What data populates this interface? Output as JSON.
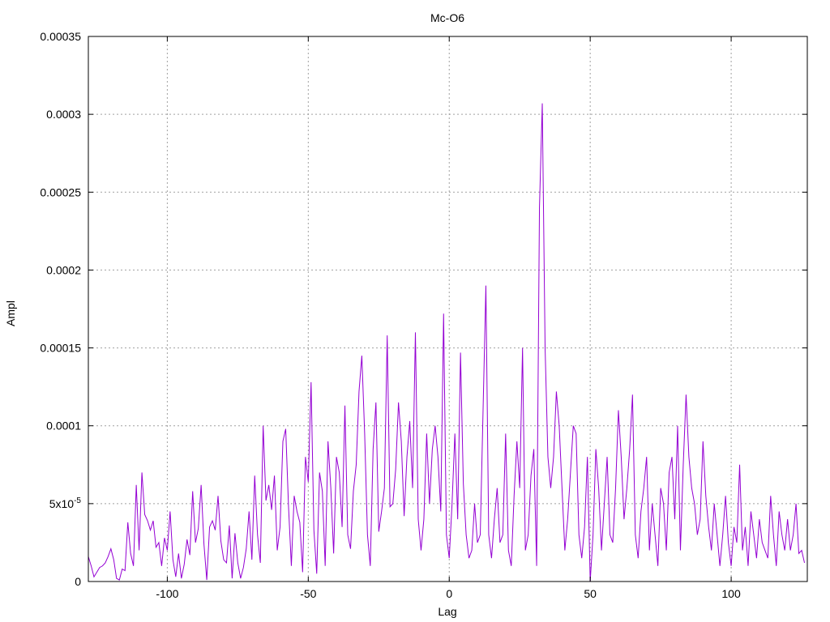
{
  "chart_data": {
    "type": "line",
    "title": "Mc-O6",
    "xlabel": "Lag",
    "ylabel": "Ampl",
    "xlim": [
      -128,
      127
    ],
    "ylim": [
      0,
      0.00035
    ],
    "grid": true,
    "x_ticks": [
      {
        "value": -100,
        "label": "-100"
      },
      {
        "value": -50,
        "label": "-50"
      },
      {
        "value": 0,
        "label": "0"
      },
      {
        "value": 50,
        "label": "50"
      },
      {
        "value": 100,
        "label": "100"
      }
    ],
    "y_ticks": [
      {
        "value": 0,
        "label": "0"
      },
      {
        "value": 5e-05,
        "label": "5x10",
        "sup": "-5"
      },
      {
        "value": 0.0001,
        "label": "0.0001"
      },
      {
        "value": 0.00015,
        "label": "0.00015"
      },
      {
        "value": 0.0002,
        "label": "0.0002"
      },
      {
        "value": 0.00025,
        "label": "0.00025"
      },
      {
        "value": 0.0003,
        "label": "0.0003"
      },
      {
        "value": 0.00035,
        "label": "0.00035"
      }
    ],
    "series": [
      {
        "color": "#9400d3",
        "x_start": -128,
        "x_step": 1,
        "values": [
          1.6e-05,
          1e-05,
          3e-06,
          6e-06,
          9e-06,
          1e-05,
          1.2e-05,
          1.6e-05,
          2.1e-05,
          1.4e-05,
          2e-06,
          1e-06,
          8e-06,
          7e-06,
          3.8e-05,
          1.8e-05,
          1e-05,
          6.2e-05,
          2e-05,
          7e-05,
          4.3e-05,
          3.9e-05,
          3.3e-05,
          3.9e-05,
          2.2e-05,
          2.5e-05,
          1e-05,
          2.8e-05,
          2e-05,
          4.5e-05,
          1.4e-05,
          3e-06,
          1.8e-05,
          2e-06,
          1.1e-05,
          2.7e-05,
          1.7e-05,
          5.8e-05,
          2.5e-05,
          3.4e-05,
          6.2e-05,
          2.4e-05,
          1e-06,
          3.5e-05,
          3.9e-05,
          3.3e-05,
          5.5e-05,
          2.6e-05,
          1.4e-05,
          1.2e-05,
          3.6e-05,
          2e-06,
          3.1e-05,
          1.2e-05,
          2e-06,
          9e-06,
          2.1e-05,
          4.5e-05,
          1.4e-05,
          6.8e-05,
          3e-05,
          1.2e-05,
          0.0001,
          5.2e-05,
          6.2e-05,
          4.6e-05,
          6.8e-05,
          2e-05,
          3.5e-05,
          9e-05,
          9.8e-05,
          4.8e-05,
          1e-05,
          5.5e-05,
          4.5e-05,
          3.8e-05,
          6e-06,
          8e-05,
          6.4e-05,
          0.000128,
          3.3e-05,
          5e-06,
          7e-05,
          5.8e-05,
          1e-05,
          9e-05,
          6e-05,
          1.8e-05,
          8e-05,
          7e-05,
          3.5e-05,
          0.000113,
          3e-05,
          2.1e-05,
          5.8e-05,
          7.5e-05,
          0.000122,
          0.000145,
          9.5e-05,
          3e-05,
          1e-05,
          8.5e-05,
          0.000115,
          3.2e-05,
          4.5e-05,
          6e-05,
          0.000158,
          4.8e-05,
          5e-05,
          7.2e-05,
          0.000115,
          9e-05,
          4.2e-05,
          8e-05,
          0.000103,
          6e-05,
          0.00016,
          4e-05,
          2e-05,
          4e-05,
          9.5e-05,
          5e-05,
          8.5e-05,
          0.0001,
          8e-05,
          4.5e-05,
          0.000172,
          3e-05,
          1.5e-05,
          5e-05,
          9.5e-05,
          4e-05,
          0.000147,
          6.3e-05,
          3e-05,
          1.5e-05,
          2e-05,
          5e-05,
          2.5e-05,
          3e-05,
          0.00011,
          0.00019,
          3e-05,
          1.5e-05,
          4e-05,
          6e-05,
          2.5e-05,
          3e-05,
          9.5e-05,
          2e-05,
          1e-05,
          5.5e-05,
          9e-05,
          6e-05,
          0.00015,
          2e-05,
          3e-05,
          6.8e-05,
          8.5e-05,
          1e-05,
          0.00024,
          0.000307,
          0.00015,
          8e-05,
          6e-05,
          8e-05,
          0.000122,
          0.0001,
          6e-05,
          2e-05,
          4e-05,
          7e-05,
          0.0001,
          9.5e-05,
          3e-05,
          1.5e-05,
          3.5e-05,
          8e-05,
          0.0,
          3e-05,
          8.5e-05,
          6e-05,
          2e-05,
          5e-05,
          8e-05,
          3e-05,
          2.5e-05,
          6e-05,
          0.00011,
          8e-05,
          4e-05,
          6e-05,
          8.5e-05,
          0.00012,
          3e-05,
          1.5e-05,
          4.5e-05,
          6e-05,
          8e-05,
          2e-05,
          5e-05,
          3e-05,
          1e-05,
          6e-05,
          5e-05,
          2e-05,
          7e-05,
          8e-05,
          4e-05,
          0.0001,
          2e-05,
          7.5e-05,
          0.00012,
          8e-05,
          6e-05,
          5e-05,
          3e-05,
          4e-05,
          9e-05,
          5.5e-05,
          3.5e-05,
          2e-05,
          5e-05,
          3e-05,
          1e-05,
          3e-05,
          5.5e-05,
          2.5e-05,
          1e-05,
          3.5e-05,
          2.5e-05,
          7.5e-05,
          2e-05,
          3.5e-05,
          1e-05,
          4.5e-05,
          3e-05,
          1.5e-05,
          4e-05,
          2.5e-05,
          2e-05,
          1.5e-05,
          5.5e-05,
          3e-05,
          1e-05,
          4.5e-05,
          3e-05,
          2e-05,
          4e-05,
          2e-05,
          3e-05,
          5e-05,
          1.8e-05,
          2e-05,
          1.2e-05
        ]
      }
    ]
  }
}
